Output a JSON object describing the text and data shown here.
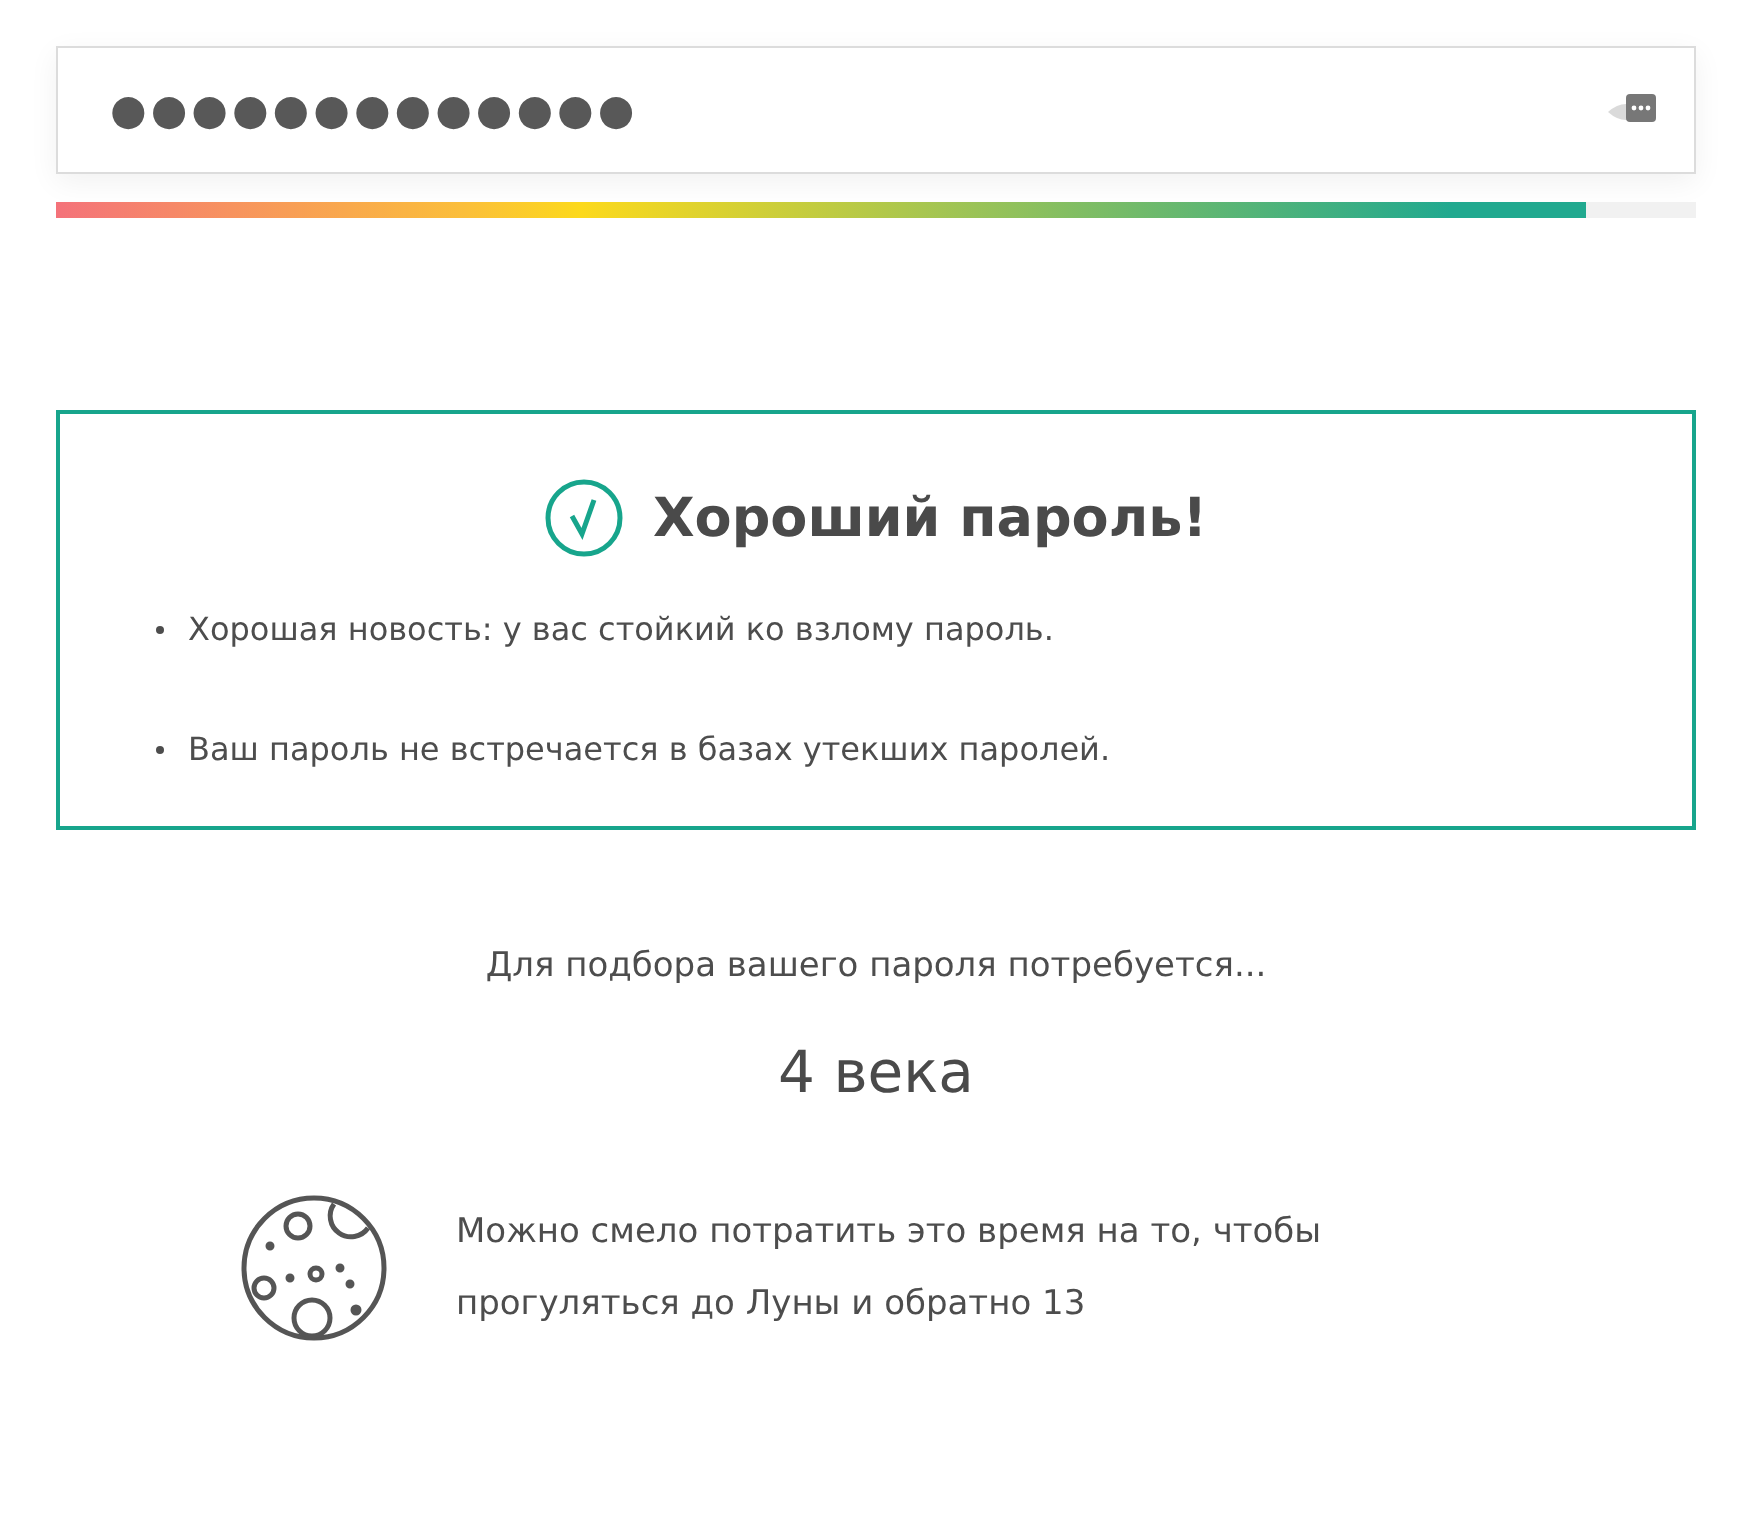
{
  "password_field": {
    "value": "●●●●●●●●●●●●●",
    "revealed": false
  },
  "strength_meter": {
    "level": 0.933
  },
  "result": {
    "passed": true,
    "title": "Хороший пароль!",
    "notes": [
      "Хорошая новость: у вас стойкий ко взлому пароль.",
      "Ваш пароль не встречается в базах утекших паролей."
    ]
  },
  "crack_time": {
    "caption": "Для подбора вашего пароля потребуется...",
    "value": "4 века"
  },
  "comparison": {
    "text": "Можно смело потратить это время на то, чтобы прогуляться до Луны и обратно 13"
  }
}
